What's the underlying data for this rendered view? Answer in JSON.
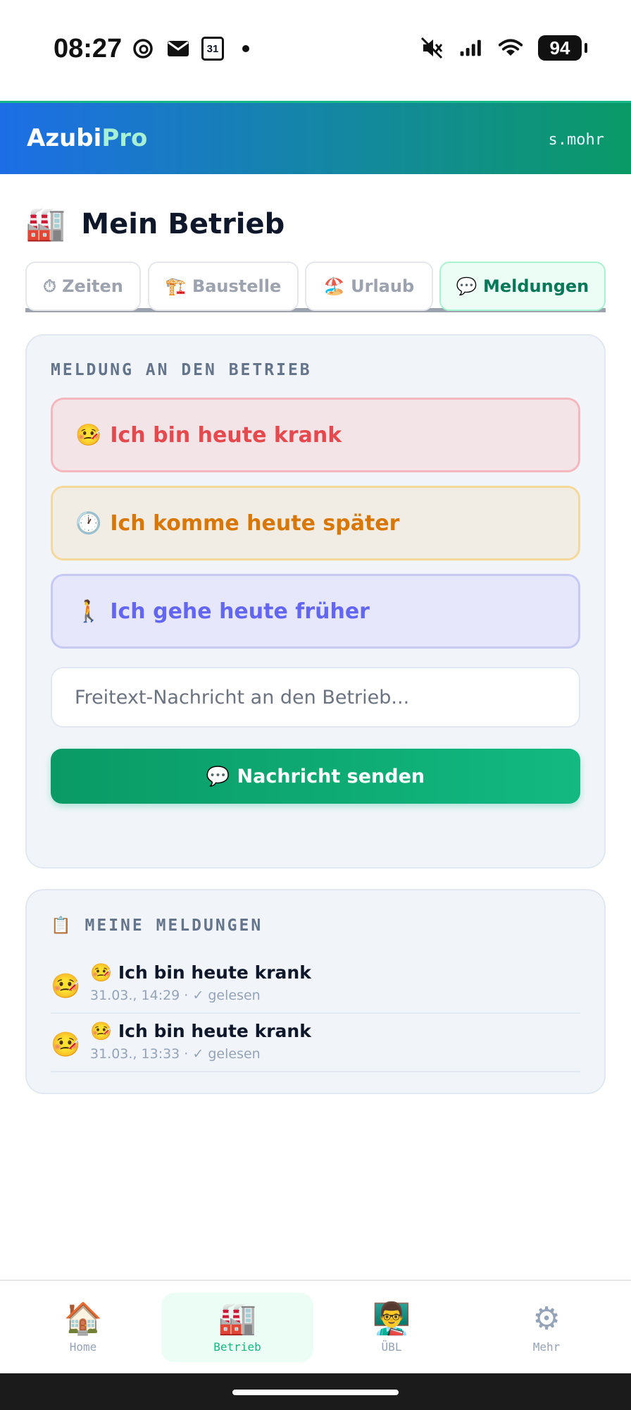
{
  "status_bar": {
    "time": "08:27",
    "calendar_day": "31",
    "battery": "94",
    "icons": [
      "threads-icon",
      "mail-icon",
      "calendar-icon",
      "dot-icon",
      "mute-icon",
      "signal-icon",
      "wifi-icon",
      "battery-icon"
    ]
  },
  "header": {
    "brand_main": "Azubi",
    "brand_accent": "Pro",
    "user": "s.mohr"
  },
  "page": {
    "title_emoji": "🏭",
    "title": "Mein Betrieb"
  },
  "tabs": [
    {
      "label": "⏱ Zeiten",
      "active": false
    },
    {
      "label": "🏗️ Baustelle",
      "active": false
    },
    {
      "label": "🏖️ Urlaub",
      "active": false
    },
    {
      "label": "💬 Meldungen",
      "active": true
    }
  ],
  "report": {
    "section_label": "MELDUNG AN DEN BETRIEB",
    "buttons": [
      {
        "emoji": "🤒",
        "label": "Ich bin heute krank"
      },
      {
        "emoji": "🕐",
        "label": "Ich komme heute später"
      },
      {
        "emoji": "🚶",
        "label": "Ich gehe heute früher"
      }
    ],
    "freetext_placeholder": "Freitext-Nachricht an den Betrieb...",
    "send_emoji": "💬",
    "send_label": "Nachricht senden"
  },
  "my_reports": {
    "section_emoji": "📋",
    "section_label": "MEINE MELDUNGEN",
    "items": [
      {
        "avatar": "🤒",
        "title": "🤒 Ich bin heute krank",
        "meta": "31.03., 14:29 · ✓ gelesen"
      },
      {
        "avatar": "🤒",
        "title": "🤒 Ich bin heute krank",
        "meta": "31.03., 13:33 · ✓ gelesen"
      }
    ]
  },
  "bottom_nav": [
    {
      "icon": "🏠",
      "label": "Home",
      "active": false
    },
    {
      "icon": "🏭",
      "label": "Betrieb",
      "active": true
    },
    {
      "icon": "👨‍🏫",
      "label": "ÜBL",
      "active": false
    },
    {
      "icon": "⚙",
      "label": "Mehr",
      "active": false
    }
  ],
  "colors": {
    "brand_gradient_start": "#1d6ee6",
    "brand_gradient_end": "#0a9a66",
    "accent_green": "#10b981",
    "krank_red": "#e5484d",
    "spaeter_orange": "#d97706",
    "frueher_indigo": "#6366f1"
  }
}
